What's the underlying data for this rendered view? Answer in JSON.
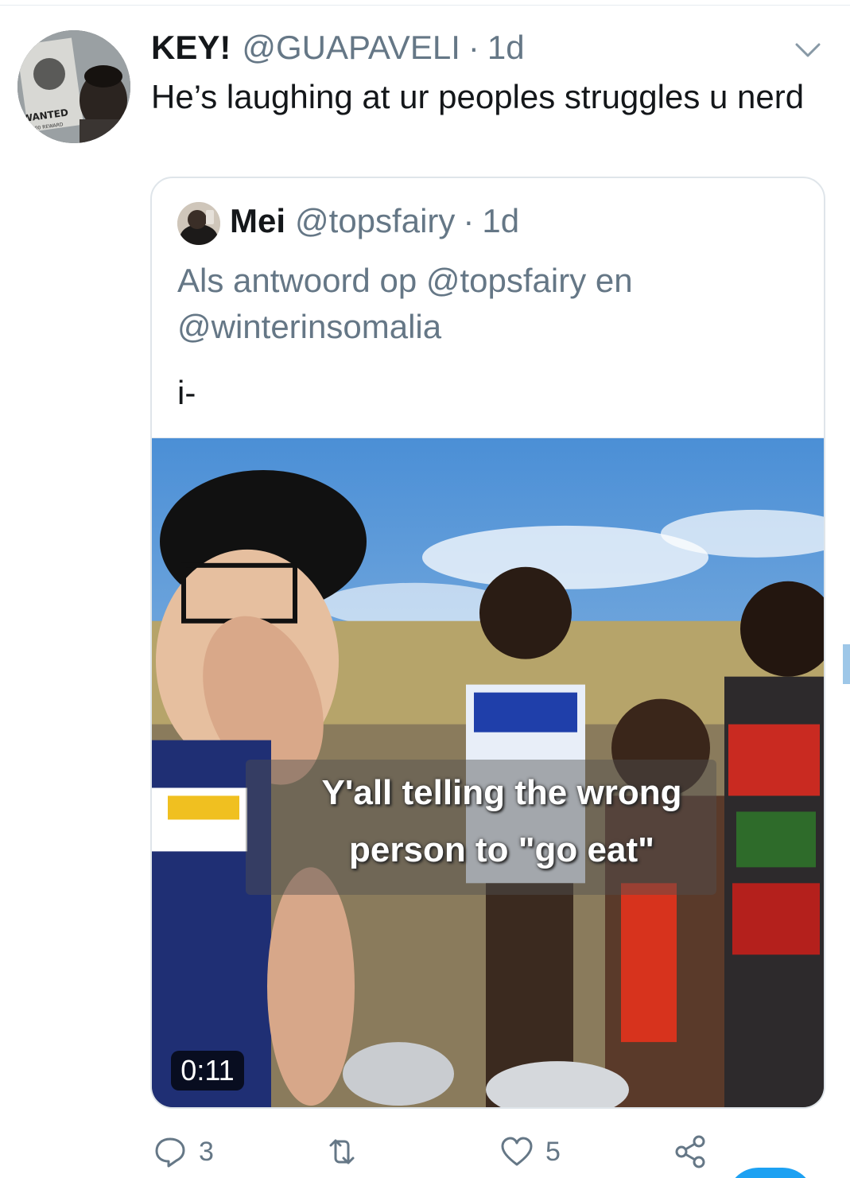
{
  "tweet": {
    "display_name": "KEY!",
    "handle": "@GUAPAVELI",
    "separator": "·",
    "time": "1d",
    "text": "He’s laughing at ur peoples struggles u nerd",
    "avatar_icon": "profile-photo",
    "avatar_overlay_text": "WANTED",
    "avatar_overlay_subtext": "$1,000 REWARD"
  },
  "quoted": {
    "display_name": "Mei",
    "handle": "@topsfairy",
    "separator": "·",
    "time": "1d",
    "reply_context": "Als antwoord op @topsfairy en @winterinsomalia",
    "text": "i-",
    "video": {
      "caption_line1": "Y'all telling the wrong",
      "caption_line2": "person to \"go eat\"",
      "duration": "0:11"
    }
  },
  "actions": {
    "reply_count": "3",
    "retweet_count": "",
    "like_count": "5",
    "icons": [
      "reply-icon",
      "retweet-icon",
      "like-icon",
      "share-icon"
    ]
  },
  "colors": {
    "text_primary": "#14171a",
    "text_secondary": "#657786",
    "border": "#dfe5ea",
    "accent": "#1da1f2"
  }
}
